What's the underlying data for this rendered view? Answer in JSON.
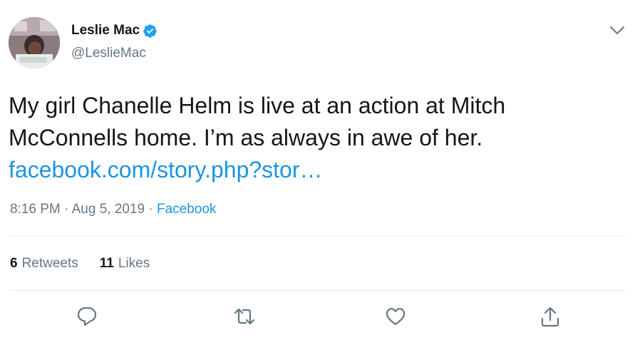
{
  "author": {
    "name": "Leslie Mac",
    "handle": "@LeslieMac",
    "verified_icon": "verified-badge-icon",
    "avatar_icon": "profile-photo"
  },
  "tweet": {
    "line1": "My girl Chanelle Helm is live at an action at Mitch",
    "line2": "McConnells home. I’m as always in awe of her.",
    "link_text": "facebook.com/story.php?stor…"
  },
  "meta": {
    "time": "8:16 PM",
    "separator1": " · ",
    "date": "Aug 5, 2019",
    "separator2": " · ",
    "source": "Facebook"
  },
  "stats": {
    "retweets_count": "6",
    "retweets_label": "Retweets",
    "likes_count": "11",
    "likes_label": "Likes"
  },
  "actions": {
    "reply_icon": "reply-icon",
    "retweet_icon": "retweet-icon",
    "like_icon": "like-icon",
    "share_icon": "share-icon",
    "menu_icon": "chevron-down-icon"
  },
  "colors": {
    "text": "#14171a",
    "secondary": "#657786",
    "link": "#1b95e0",
    "verified": "#1da1f2",
    "divider": "#e6ecf0"
  }
}
